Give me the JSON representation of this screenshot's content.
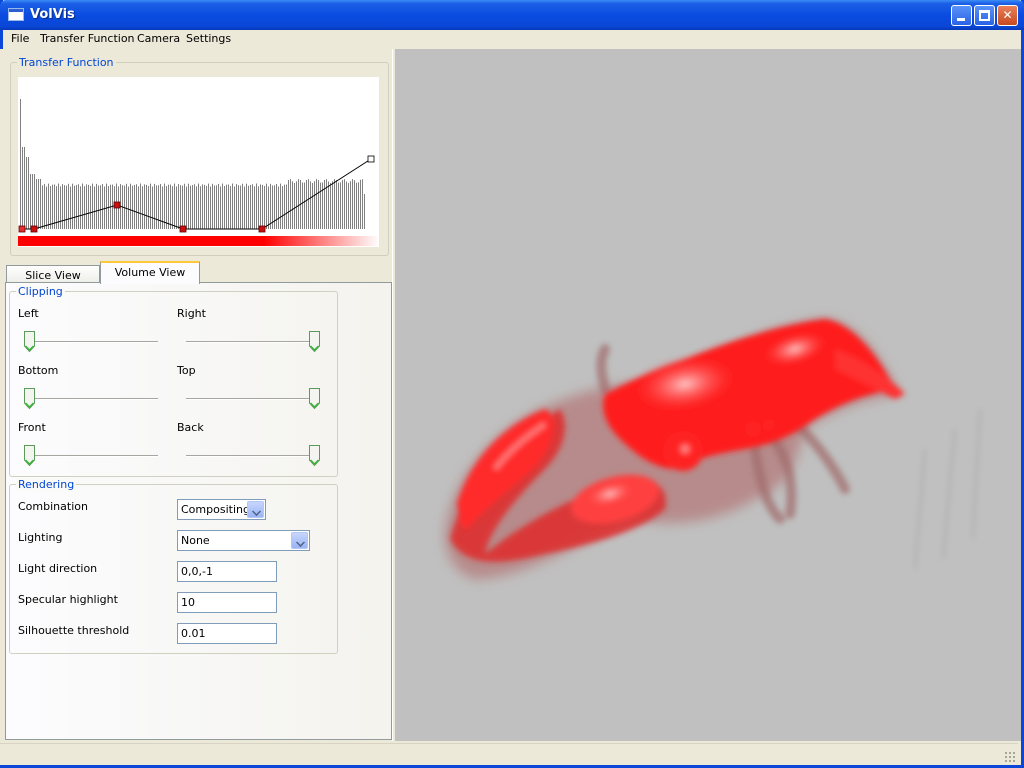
{
  "window": {
    "title": "VolVis"
  },
  "menu": [
    "File",
    "Transfer Function",
    "Camera",
    "Settings"
  ],
  "transfer_function": {
    "title": "Transfer Function",
    "histogram_color": "#808080",
    "curve_color": "#000000",
    "control_point_color": "#c81010",
    "gradient_colors": [
      "#ff0000",
      "#ffffff"
    ]
  },
  "tabs": [
    {
      "label": "Slice View",
      "active": false
    },
    {
      "label": "Volume View",
      "active": true
    }
  ],
  "clipping": {
    "title": "Clipping",
    "sliders": [
      {
        "label": "Left",
        "value": 0
      },
      {
        "label": "Right",
        "value": 1
      },
      {
        "label": "Bottom",
        "value": 0
      },
      {
        "label": "Top",
        "value": 1
      },
      {
        "label": "Front",
        "value": 0
      },
      {
        "label": "Back",
        "value": 1
      }
    ]
  },
  "rendering": {
    "title": "Rendering",
    "combination": {
      "label": "Combination",
      "value": "Compositing"
    },
    "lighting": {
      "label": "Lighting",
      "value": "None"
    },
    "light_direction": {
      "label": "Light direction",
      "value": "0,0,-1"
    },
    "specular_highlight": {
      "label": "Specular highlight",
      "value": "10"
    },
    "silhouette_threshold": {
      "label": "Silhouette threshold",
      "value": "0.01"
    }
  },
  "viewport": {
    "background": "#c0c0c0",
    "subject": "lobster volume rendering",
    "render_color": "#ff1a1a"
  }
}
